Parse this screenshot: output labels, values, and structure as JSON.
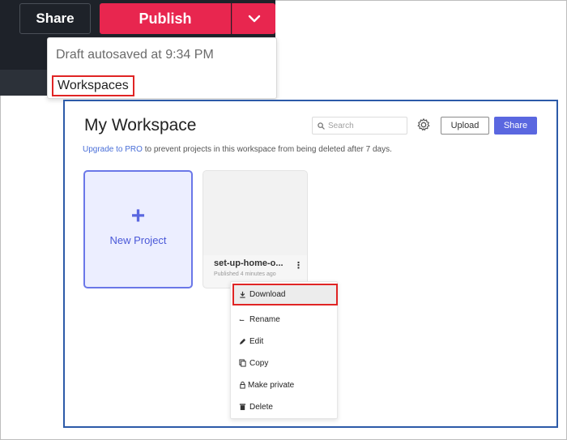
{
  "editor": {
    "share_label": "Share",
    "publish_label": "Publish",
    "autosave_text": "Draft autosaved at 9:34 PM",
    "workspaces_label": "Workspaces"
  },
  "workspace": {
    "title": "My Workspace",
    "search_placeholder": "Search",
    "upload_label": "Upload",
    "share_label": "Share",
    "upgrade_link": "Upgrade to PRO",
    "upgrade_text": " to prevent projects in this workspace from being deleted after 7 days.",
    "new_project_label": "New Project",
    "project": {
      "name": "set-up-home-o...",
      "meta": "Published 4 minutes ago"
    },
    "menu": {
      "download": "Download",
      "rename": "Rename",
      "edit": "Edit",
      "copy": "Copy",
      "make_private": "Make private",
      "delete": "Delete"
    }
  },
  "colors": {
    "publish": "#e8264f",
    "accent": "#5a67e0",
    "highlight_border": "#e02424",
    "panel_border": "#2c5aa8"
  }
}
